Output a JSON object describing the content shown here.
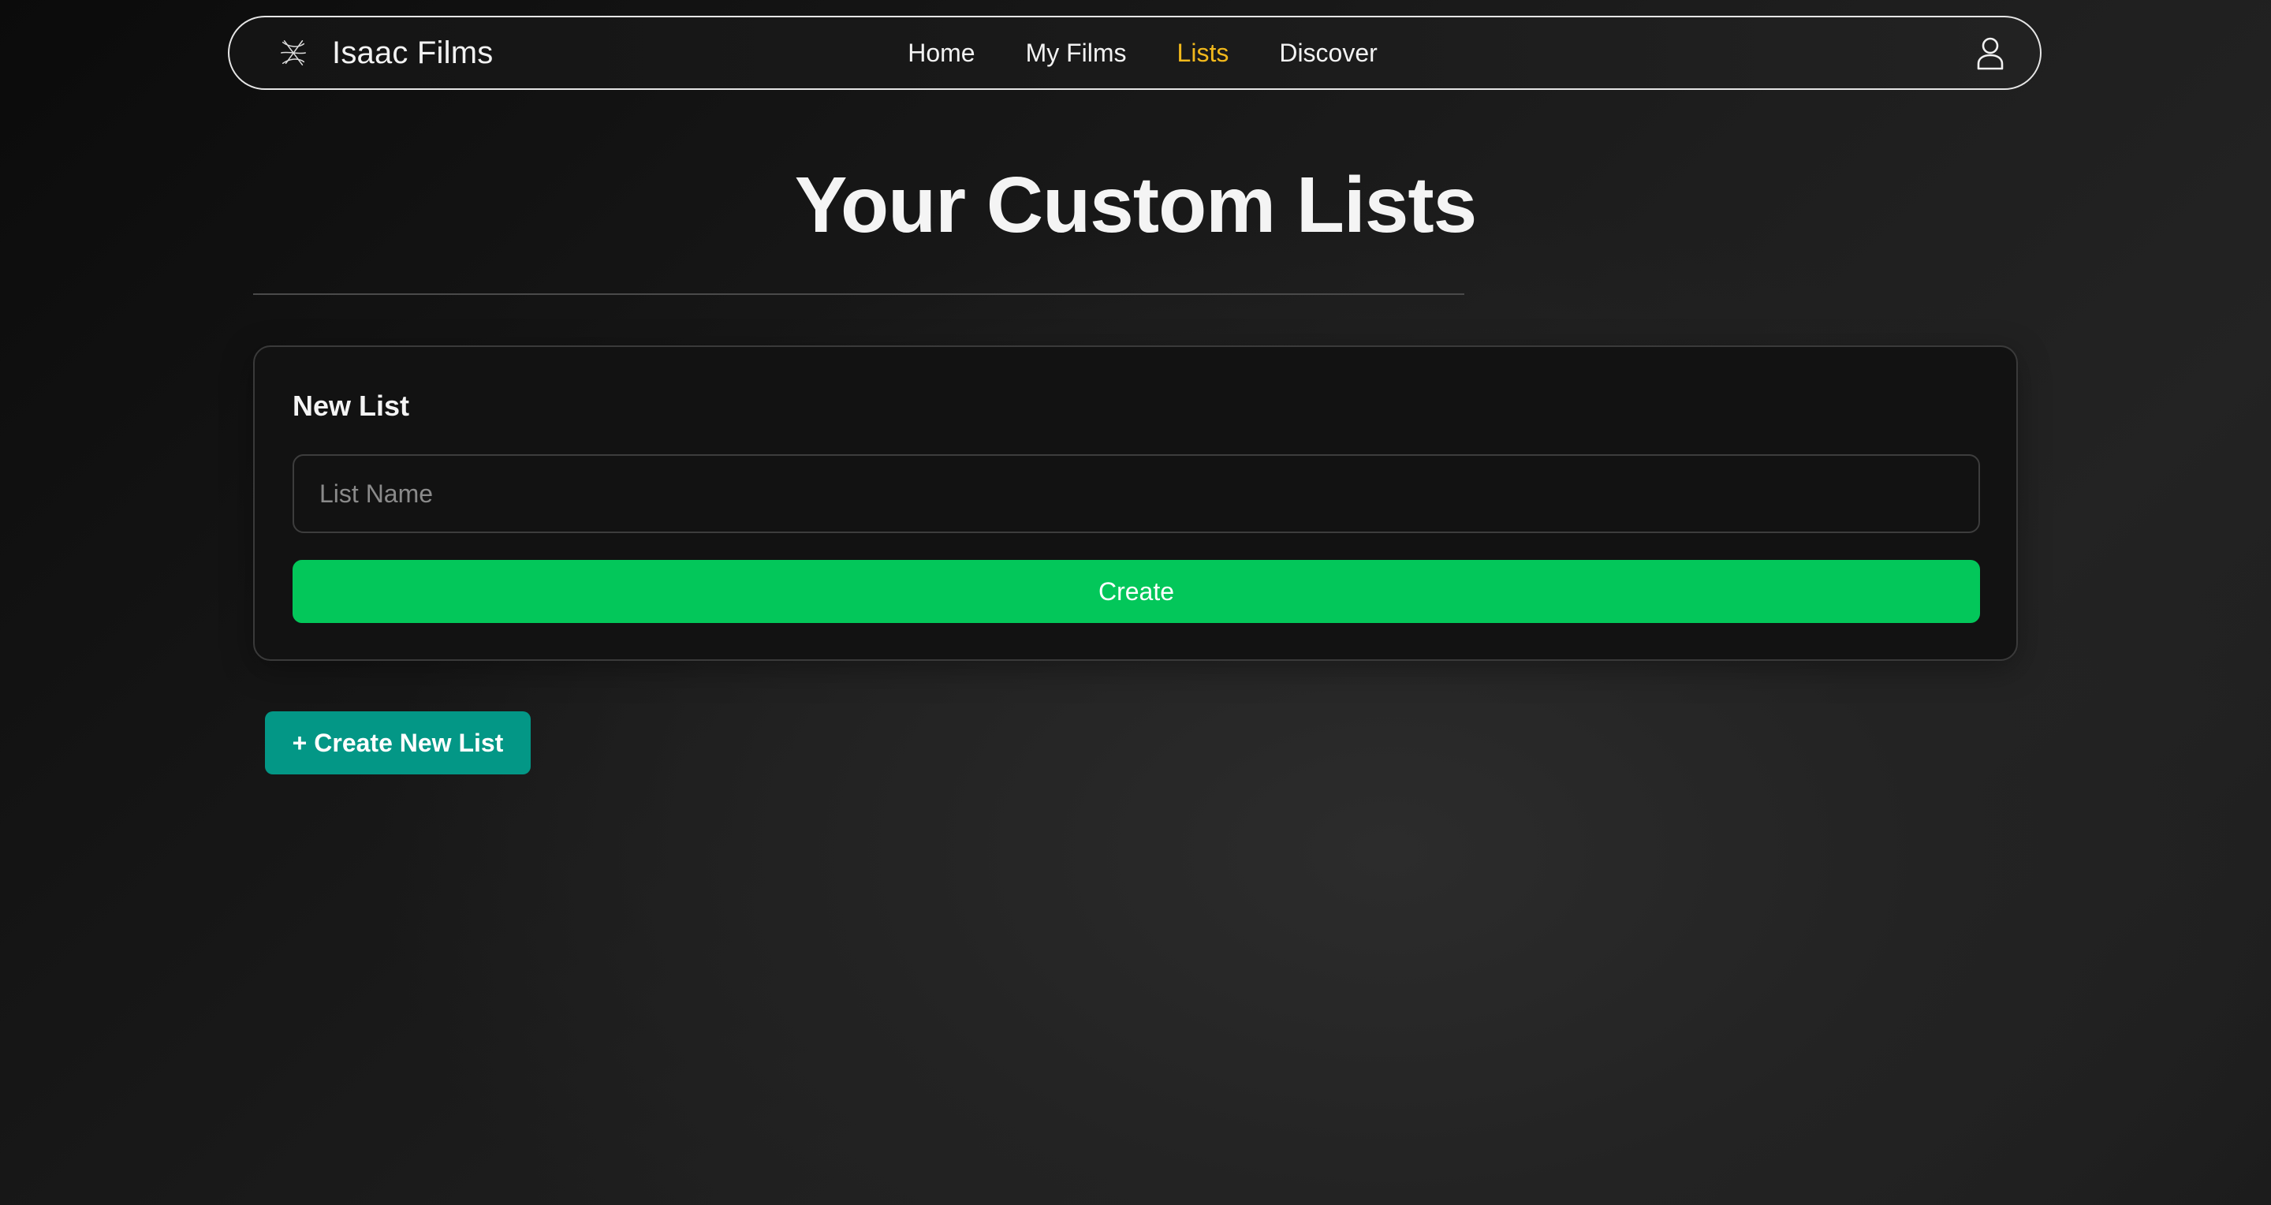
{
  "nav": {
    "brand_name": "Isaac Films",
    "brand_icon": "film-reel-icon",
    "links": [
      {
        "label": "Home",
        "active": false
      },
      {
        "label": "My Films",
        "active": false
      },
      {
        "label": "Lists",
        "active": true
      },
      {
        "label": "Discover",
        "active": false
      }
    ],
    "active_color": "#f2b91c",
    "profile_icon": "user-icon"
  },
  "page": {
    "title": "Your Custom Lists"
  },
  "new_list_card": {
    "title": "New List",
    "input_placeholder": "List Name",
    "input_value": "",
    "create_label": "Create",
    "create_color": "#03c75a"
  },
  "create_new_list_button": {
    "label": "+ Create New List",
    "color": "#039786"
  }
}
